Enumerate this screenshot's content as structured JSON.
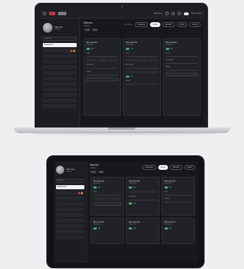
{
  "app": {
    "user_name": "Marcelo",
    "user_sub": "Admin",
    "search_placeholder": "Search",
    "header_title": "Marcelo",
    "header_sub": "Settings",
    "chips": [
      "Code",
      "Edit"
    ],
    "topbar_user": "Marcelo ▾",
    "topbar_mode": "Dark mode",
    "tabs_label": "Sort Order:",
    "tabs": [
      "Equalizer",
      "Mixer",
      "Speaker",
      "Lights",
      "Events"
    ],
    "active_tab_index": 1,
    "sidebar_items": [
      {
        "label": "Dashboard"
      },
      {
        "label": "Item 2"
      },
      {
        "label": "Item 3"
      },
      {
        "label": "Item 4"
      },
      {
        "label": "Item 5"
      },
      {
        "label": "Item 6"
      },
      {
        "label": "Item 7"
      },
      {
        "label": "Item 8"
      },
      {
        "label": "Item 9"
      },
      {
        "label": "Item 10"
      },
      {
        "label": "Item 11"
      },
      {
        "label": "Item 12"
      }
    ],
    "cards": [
      {
        "title": "Microsonde",
        "sub": "Channel 1",
        "on": "On",
        "field_a": "Gain",
        "field_b": "Threshold",
        "field_c": "Attack",
        "select": "Select"
      },
      {
        "title": "Microsonde",
        "sub": "Channel 2",
        "on": "On",
        "field_a": "Gain",
        "field_b": "Threshold",
        "field_c": "Attack",
        "select": "Select"
      },
      {
        "title": "Microsonde",
        "sub": "Channel 3",
        "on": "On",
        "field_a": "Gain",
        "field_b": "Threshold",
        "field_c": "Attack",
        "select": "Select"
      }
    ]
  },
  "colors": {
    "accent_red": "#c7323a",
    "on_green": "#39b76a",
    "badge_red": "#e04a4a",
    "badge_orange": "#e8913a"
  }
}
